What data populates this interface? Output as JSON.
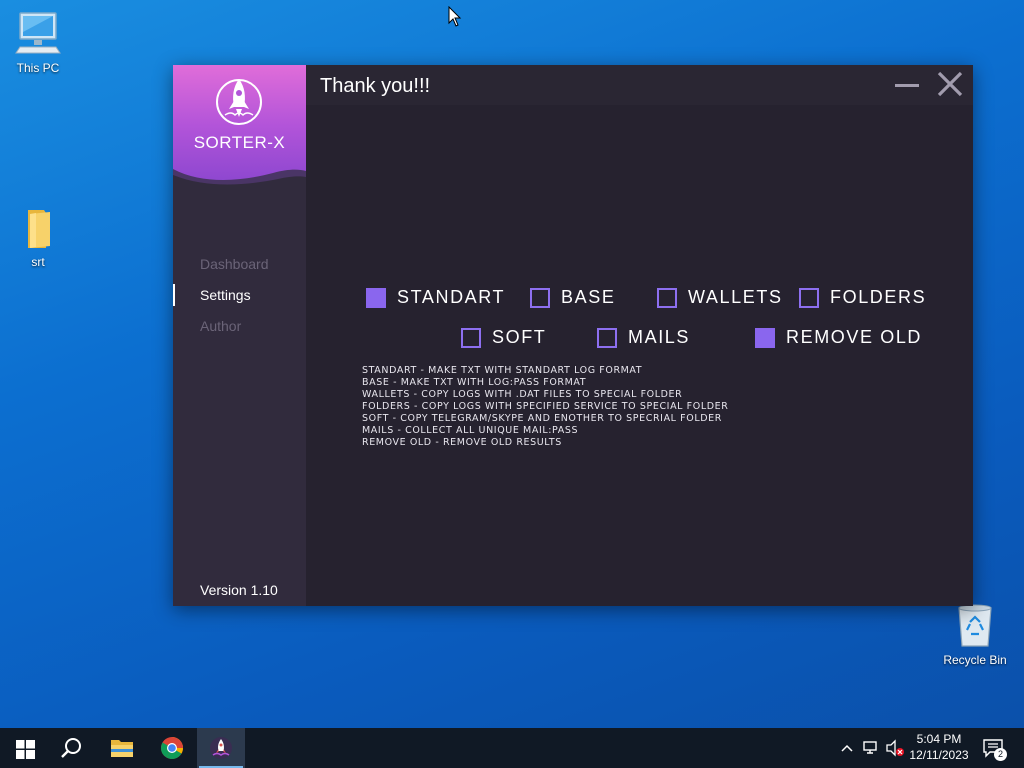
{
  "desktop": {
    "icons": [
      {
        "label": "This PC",
        "icon": "computer-icon"
      },
      {
        "label": "srt",
        "icon": "folder-icon"
      },
      {
        "label": "Recycle Bin",
        "icon": "recycle-bin-icon"
      }
    ]
  },
  "app": {
    "brand_name": "SORTER-X",
    "window_title": "Thank you!!!",
    "nav": [
      {
        "label": "Dashboard",
        "active": false
      },
      {
        "label": "Settings",
        "active": true
      },
      {
        "label": "Author",
        "active": false
      }
    ],
    "version": "Version 1.10",
    "options": [
      {
        "label": "STANDART",
        "checked": true
      },
      {
        "label": "BASE",
        "checked": false
      },
      {
        "label": "WALLETS",
        "checked": false
      },
      {
        "label": "FOLDERS",
        "checked": false
      },
      {
        "label": "SOFT",
        "checked": false
      },
      {
        "label": "MAILS",
        "checked": false
      },
      {
        "label": "REMOVE OLD",
        "checked": true
      }
    ],
    "descriptions": [
      "STANDART - MAKE TXT WITH STANDART LOG FORMAT",
      "BASE - MAKE TXT WITH LOG:PASS FORMAT",
      "WALLETS - COPY LOGS WITH .DAT FILES TO SPECIAL FOLDER",
      "FOLDERS - COPY LOGS WITH SPECIFIED SERVICE TO SPECIAL FOLDER",
      "SOFT - COPY TELEGRAM/SKYPE AND ENOTHER TO SPECRIAL FOLDER",
      "MAILS - COLLECT ALL UNIQUE MAIL:PASS",
      "REMOVE OLD - REMOVE OLD RESULTS"
    ],
    "colors": {
      "accent": "#8a66ee",
      "window_bg": "#26222f",
      "sidebar_bg": "#312b3d"
    }
  },
  "taskbar": {
    "apps": [
      "windows-start-icon",
      "search-icon",
      "file-explorer-icon",
      "chrome-icon",
      "sorter-x-icon"
    ],
    "time": "5:04 PM",
    "date": "12/11/2023",
    "notifications": "2"
  }
}
